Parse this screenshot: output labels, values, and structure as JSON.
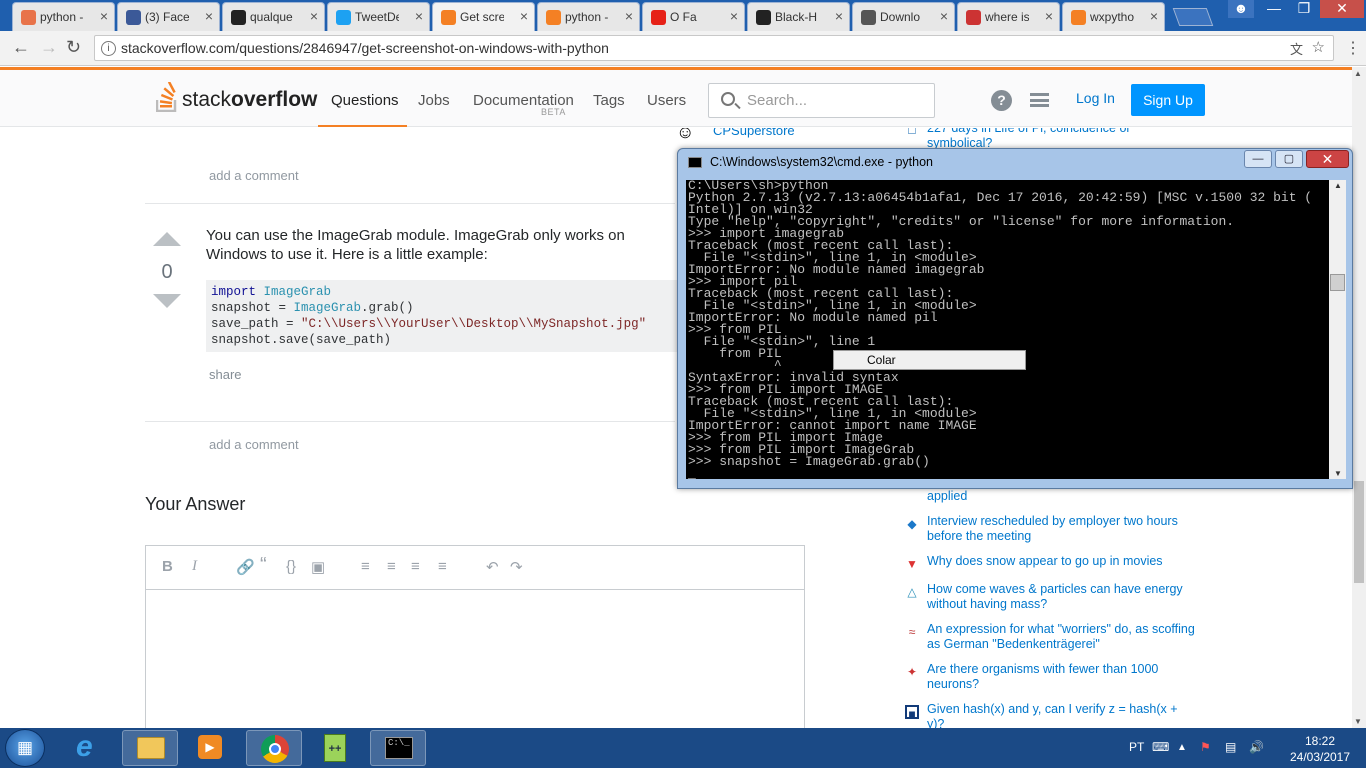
{
  "browser": {
    "tabs": [
      {
        "label": "python -",
        "icon": "python-tab",
        "color": "#e8734a"
      },
      {
        "label": "(3) Faceb",
        "icon": "facebook",
        "color": "#3b5998"
      },
      {
        "label": "qualque",
        "icon": "github",
        "color": "#222"
      },
      {
        "label": "TweetDe",
        "icon": "twitter",
        "color": "#1da1f2"
      },
      {
        "label": "Get scre",
        "icon": "stackoverflow",
        "color": "#f48024"
      },
      {
        "label": "python -",
        "icon": "stackoverflow",
        "color": "#f48024"
      },
      {
        "label": "O Fa",
        "icon": "youtube",
        "color": "#e62117"
      },
      {
        "label": "Black-H",
        "icon": "github",
        "color": "#222"
      },
      {
        "label": "Downlo",
        "icon": "download",
        "color": "#555"
      },
      {
        "label": "where is",
        "icon": "flame",
        "color": "#c33"
      },
      {
        "label": "wxpytho",
        "icon": "stackoverflow",
        "color": "#f48024"
      }
    ],
    "url": "stackoverflow.com/questions/2846947/get-screenshot-on-windows-with-python"
  },
  "so": {
    "logo_light": "stack",
    "logo_bold": "overflow",
    "nav": [
      "Questions",
      "Jobs",
      "Documentation",
      "Tags",
      "Users"
    ],
    "beta": "BETA",
    "search_placeholder": "Search...",
    "login": "Log In",
    "signup": "Sign Up"
  },
  "answer": {
    "add_comment_1": "add a comment",
    "votes": "0",
    "text": "You can use the ImageGrab module. ImageGrab only works on Windows to use it. Here is a little example:",
    "code": [
      [
        {
          "c": "k",
          "t": "import "
        },
        {
          "c": "t",
          "t": "ImageGrab"
        }
      ],
      [
        {
          "c": "",
          "t": "snapshot = "
        },
        {
          "c": "t",
          "t": "ImageGrab"
        },
        {
          "c": "",
          "t": ".grab()"
        }
      ],
      [
        {
          "c": "",
          "t": "save_path = "
        },
        {
          "c": "s",
          "t": "\"C:\\\\Users\\\\YourUser\\\\Desktop\\\\MySnapshot.jpg\""
        }
      ],
      [
        {
          "c": "",
          "t": "snapshot.save(save_path)"
        }
      ]
    ],
    "share": "share",
    "add_comment_2": "add a comment",
    "your_answer": "Your Answer"
  },
  "editor_icons": [
    "bold-icon",
    "italic-icon",
    "link-icon",
    "quote-icon",
    "code-icon",
    "image-icon",
    "ordered-list-icon",
    "bullet-list-icon",
    "heading-icon",
    "rule-icon",
    "undo-icon",
    "redo-icon"
  ],
  "sidebar": {
    "cps_user": "CPSuperstore",
    "hot": [
      {
        "text": "227 days in Life of Pi, coincidence or symbolical?",
        "icon": "#0a62ad"
      },
      {
        "text": "applied",
        "icon": ""
      },
      {
        "text": "Interview rescheduled by employer two hours before the meeting",
        "icon": "#1b78c9"
      },
      {
        "text": "Why does snow appear to go up in movies",
        "icon": "#d33"
      },
      {
        "text": "How come waves & particles can have energy without having mass?",
        "icon": "#2a8fb8"
      },
      {
        "text": "An expression for what \"worriers\" do, as scoffing as German \"Bedenkenträgerei\"",
        "icon": "#b33"
      },
      {
        "text": "Are there organisms with fewer than 1000 neurons?",
        "icon": "#c33"
      },
      {
        "text": "Given hash(x) and y, can I verify z = hash(x + y)?",
        "icon": "#123b79"
      }
    ]
  },
  "cmd": {
    "title": "C:\\Windows\\system32\\cmd.exe - python",
    "lines": [
      "C:\\Users\\sh>python",
      "Python 2.7.13 (v2.7.13:a06454b1afa1, Dec 17 2016, 20:42:59) [MSC v.1500 32 bit (",
      "Intel)] on win32",
      "Type \"help\", \"copyright\", \"credits\" or \"license\" for more information.",
      ">>> import imagegrab",
      "Traceback (most recent call last):",
      "  File \"<stdin>\", line 1, in <module>",
      "ImportError: No module named imagegrab",
      ">>> import pil",
      "Traceback (most recent call last):",
      "  File \"<stdin>\", line 1, in <module>",
      "ImportError: No module named pil",
      ">>> from PIL",
      "  File \"<stdin>\", line 1",
      "    from PIL",
      "           ^",
      "SyntaxError: invalid syntax",
      ">>> from PIL import IMAGE",
      "Traceback (most recent call last):",
      "  File \"<stdin>\", line 1, in <module>",
      "ImportError: cannot import name IMAGE",
      ">>> from PIL import Image",
      ">>> from PIL import ImageGrab",
      ">>> snapshot = ImageGrab.grab()",
      "_"
    ],
    "context_menu": "Colar"
  },
  "taskbar": {
    "apps": [
      "windows-start",
      "internet-explorer",
      "file-explorer",
      "media-player",
      "chrome",
      "notepad-plus-plus",
      "cmd"
    ],
    "lang": "PT",
    "time": "18:22",
    "date": "24/03/2017"
  }
}
